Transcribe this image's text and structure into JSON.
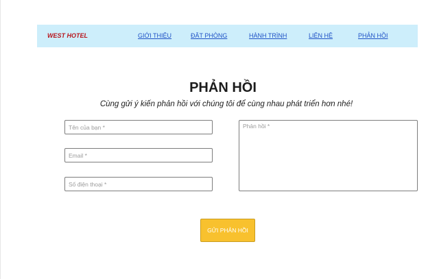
{
  "nav": {
    "brand": "WEST HOTEL",
    "links": [
      "GIỚI THIỆU",
      "ĐẶT PHÒNG",
      "HÀNH TRÌNH",
      "LIÊN HỆ",
      "PHẢN HỒI"
    ]
  },
  "feedback": {
    "title": "PHẢN HỒI",
    "subtitle": "Cùng gửi ý kiến phản hồi với chúng tôi để cùng nhau phát triển hơn nhé!",
    "name_placeholder": "Tên của bạn *",
    "email_placeholder": "Email *",
    "phone_placeholder": "Số điện thoại *",
    "message_placeholder": "Phản hồi *",
    "submit_label": "GỬI PHẢN HỒI"
  },
  "colors": {
    "navbar_bg": "#cdeefb",
    "brand": "#b8161d",
    "link": "#1f52c6",
    "submit_bg": "#f8c12e"
  }
}
